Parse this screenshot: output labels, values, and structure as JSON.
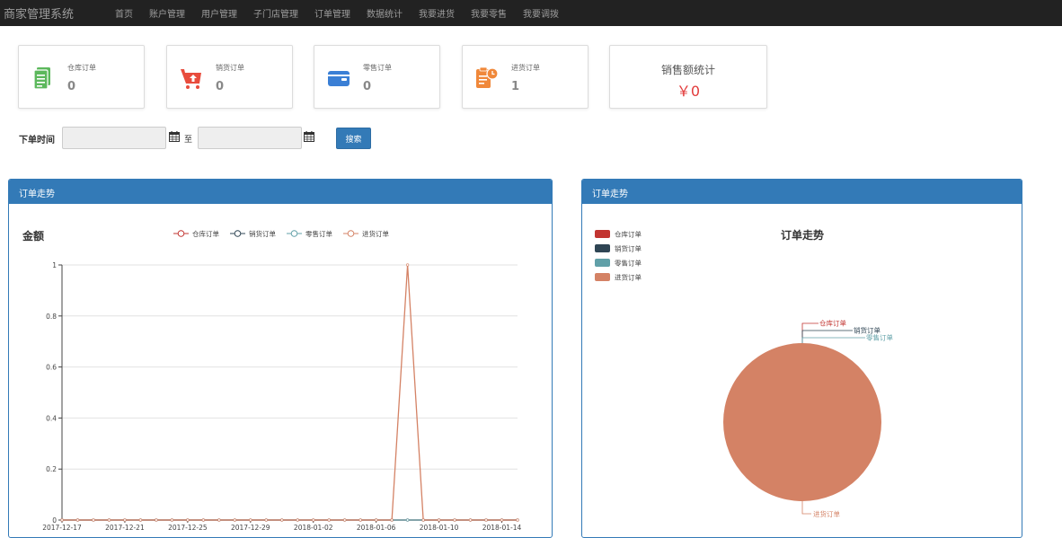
{
  "navbar": {
    "brand": "商家管理系统",
    "items": [
      "首页",
      "账户管理",
      "用户管理",
      "子门店管理",
      "订单管理",
      "数据统计",
      "我要进货",
      "我要零售",
      "我要调拨"
    ]
  },
  "stats": [
    {
      "label": "仓库订单",
      "value": "0",
      "icon": "document-icon",
      "color": "#5cb85c"
    },
    {
      "label": "销货订单",
      "value": "0",
      "icon": "cart-upload-icon",
      "color": "#e84c3d"
    },
    {
      "label": "零售订单",
      "value": "0",
      "icon": "wallet-icon",
      "color": "#3a7fd5"
    },
    {
      "label": "进货订单",
      "value": "1",
      "icon": "clipboard-clock-icon",
      "color": "#f0883a"
    }
  ],
  "sales": {
    "title": "销售额统计",
    "amount": "￥0"
  },
  "search": {
    "label": "下单时间",
    "to": "至",
    "button": "搜索",
    "from_value": "",
    "to_value": ""
  },
  "panels": {
    "line_title": "订单走势",
    "pie_title": "订单走势"
  },
  "chart_data": [
    {
      "type": "line",
      "title": "金额",
      "x": [
        "2017-12-17",
        "2017-12-18",
        "2017-12-19",
        "2017-12-20",
        "2017-12-21",
        "2017-12-22",
        "2017-12-23",
        "2017-12-24",
        "2017-12-25",
        "2017-12-26",
        "2017-12-27",
        "2017-12-28",
        "2017-12-29",
        "2017-12-30",
        "2017-12-31",
        "2018-01-01",
        "2018-01-02",
        "2018-01-03",
        "2018-01-04",
        "2018-01-05",
        "2018-01-06",
        "2018-01-07",
        "2018-01-08",
        "2018-01-09",
        "2018-01-10",
        "2018-01-11",
        "2018-01-12",
        "2018-01-13",
        "2018-01-14",
        "2018-01-15"
      ],
      "x_tick_labels": [
        "2017-12-17",
        "2017-12-21",
        "2017-12-25",
        "2017-12-29",
        "2018-01-02",
        "2018-01-06",
        "2018-01-10",
        "2018-01-14"
      ],
      "ylim": [
        0,
        1
      ],
      "y_ticks": [
        "0",
        "0.2",
        "0.4",
        "0.6",
        "0.8",
        "1"
      ],
      "grid": true,
      "legend_position": "top-center",
      "series": [
        {
          "name": "仓库订单",
          "color": "#c23531",
          "values": [
            0,
            0,
            0,
            0,
            0,
            0,
            0,
            0,
            0,
            0,
            0,
            0,
            0,
            0,
            0,
            0,
            0,
            0,
            0,
            0,
            0,
            0,
            0,
            0,
            0,
            0,
            0,
            0,
            0,
            0
          ]
        },
        {
          "name": "销货订单",
          "color": "#2f4554",
          "values": [
            0,
            0,
            0,
            0,
            0,
            0,
            0,
            0,
            0,
            0,
            0,
            0,
            0,
            0,
            0,
            0,
            0,
            0,
            0,
            0,
            0,
            0,
            0,
            0,
            0,
            0,
            0,
            0,
            0,
            0
          ]
        },
        {
          "name": "零售订单",
          "color": "#61a0a8",
          "values": [
            0,
            0,
            0,
            0,
            0,
            0,
            0,
            0,
            0,
            0,
            0,
            0,
            0,
            0,
            0,
            0,
            0,
            0,
            0,
            0,
            0,
            0,
            0,
            0,
            0,
            0,
            0,
            0,
            0,
            0
          ]
        },
        {
          "name": "进货订单",
          "color": "#d48265",
          "values": [
            0,
            0,
            0,
            0,
            0,
            0,
            0,
            0,
            0,
            0,
            0,
            0,
            0,
            0,
            0,
            0,
            0,
            0,
            0,
            0,
            0,
            0,
            1,
            0,
            0,
            0,
            0,
            0,
            0,
            0
          ]
        }
      ]
    },
    {
      "type": "pie",
      "title": "订单走势",
      "legend_position": "top-left",
      "slices": [
        {
          "name": "仓库订单",
          "value": 0,
          "color": "#c23531"
        },
        {
          "name": "销货订单",
          "value": 0,
          "color": "#2f4554"
        },
        {
          "name": "零售订单",
          "value": 0,
          "color": "#61a0a8"
        },
        {
          "name": "进货订单",
          "value": 1,
          "color": "#d48265"
        }
      ]
    }
  ]
}
